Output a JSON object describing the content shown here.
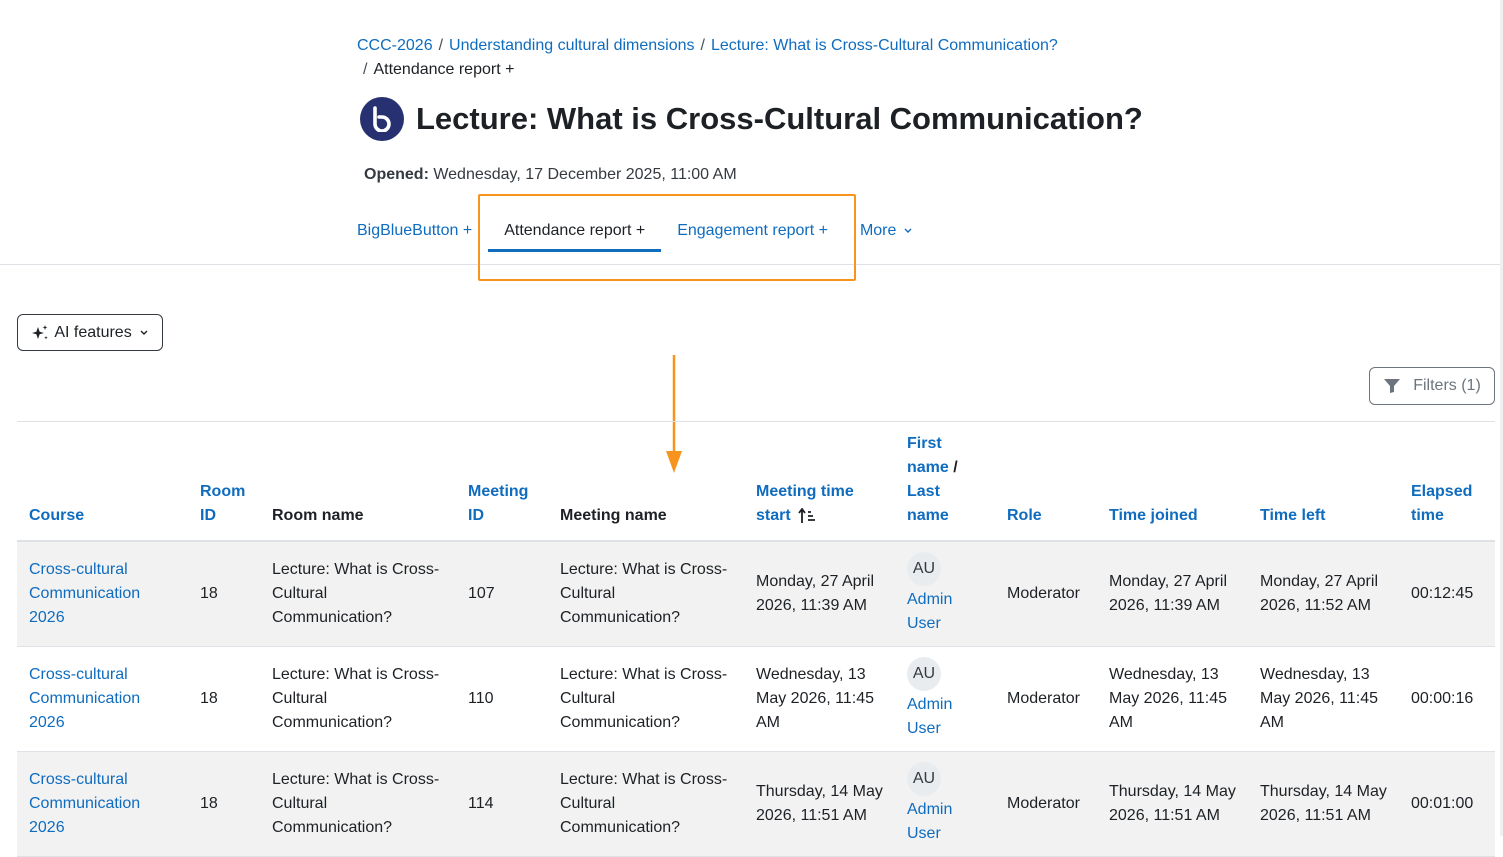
{
  "breadcrumb": {
    "items": [
      "CCC-2026",
      "Understanding cultural dimensions",
      "Lecture: What is Cross-Cultural Communication?",
      "Attendance report +"
    ],
    "separator": "/"
  },
  "header": {
    "icon": "bigbluebutton-icon",
    "title": "Lecture: What is Cross-Cultural Communication?",
    "opened_label": "Opened:",
    "opened_value": "Wednesday, 17 December 2025, 11:00 AM"
  },
  "secondary_nav": {
    "tabs": [
      "BigBlueButton +",
      "Attendance report +",
      "Engagement report +",
      "More"
    ],
    "active": "Attendance report +"
  },
  "toolbar": {
    "ai_label": "AI features",
    "filters_label": "Filters (1)"
  },
  "table": {
    "headers": [
      "Course",
      "Room ID",
      "Room name",
      "Meeting ID",
      "Meeting name",
      "Meeting time start",
      "First name",
      "/",
      "Last name",
      "Role",
      "Time joined",
      "Time left",
      "Elapsed time"
    ],
    "rows": [
      {
        "course": "Cross-cultural Communication 2026",
        "room_id": "18",
        "room_name": "Lecture: What is Cross-Cultural Communication?",
        "meeting_id": "107",
        "meeting_name": "Lecture: What is Cross-Cultural Communication?",
        "meeting_start": "Monday, 27 April 2026, 11:39 AM",
        "initials": "AU",
        "user": "Admin User",
        "role": "Moderator",
        "joined": "Monday, 27 April 2026, 11:39 AM",
        "left": "Monday, 27 April 2026, 11:52 AM",
        "elapsed": "00:12:45"
      },
      {
        "course": "Cross-cultural Communication 2026",
        "room_id": "18",
        "room_name": "Lecture: What is Cross-Cultural Communication?",
        "meeting_id": "110",
        "meeting_name": "Lecture: What is Cross-Cultural Communication?",
        "meeting_start": "Wednesday, 13 May 2026, 11:45 AM",
        "initials": "AU",
        "user": "Admin User",
        "role": "Moderator",
        "joined": "Wednesday, 13 May 2026, 11:45 AM",
        "left": "Wednesday, 13 May 2026, 11:45 AM",
        "elapsed": "00:00:16"
      },
      {
        "course": "Cross-cultural Communication 2026",
        "room_id": "18",
        "room_name": "Lecture: What is Cross-Cultural Communication?",
        "meeting_id": "114",
        "meeting_name": "Lecture: What is Cross-Cultural Communication?",
        "meeting_start": "Thursday, 14 May 2026, 11:51 AM",
        "initials": "AU",
        "user": "Admin User",
        "role": "Moderator",
        "joined": "Thursday, 14 May 2026, 11:51 AM",
        "left": "Thursday, 14 May 2026, 11:51 AM",
        "elapsed": "00:01:00"
      }
    ]
  },
  "colors": {
    "link": "#0f6cbf",
    "highlight": "#f7941d",
    "bbb_brand": "#273171",
    "row_stripe": "#f2f2f2"
  }
}
